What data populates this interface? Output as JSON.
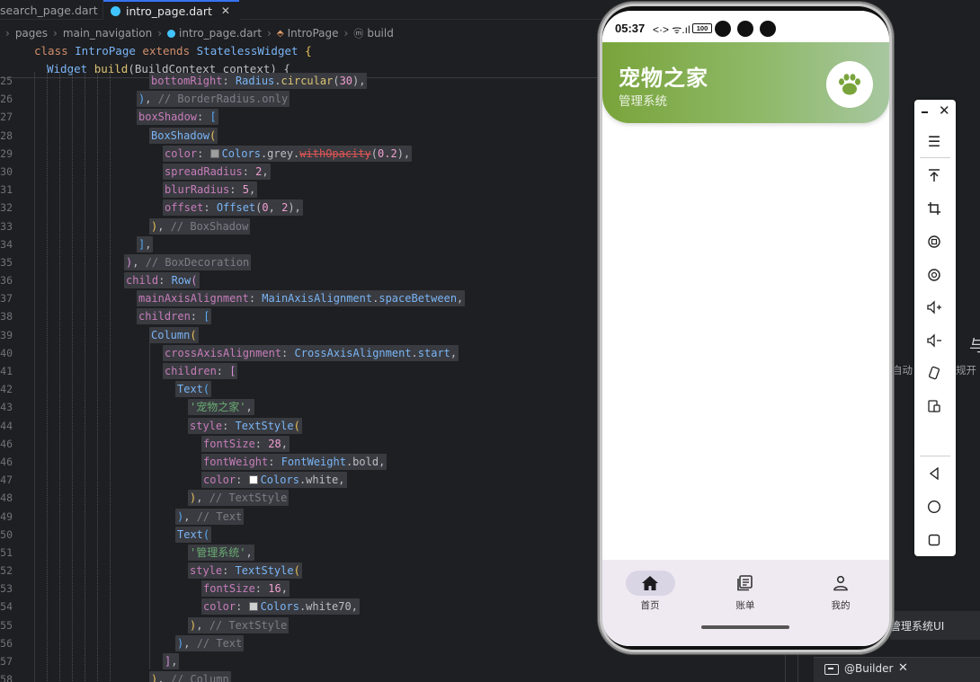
{
  "editor": {
    "tabs": [
      {
        "label": "search_page.dart",
        "active": false
      },
      {
        "label": "intro_page.dart",
        "active": true,
        "close": "✕"
      }
    ],
    "breadcrumb": [
      "pages",
      "main_navigation",
      "intro_page.dart",
      "IntroPage",
      "build"
    ],
    "sticky": [
      {
        "a": "class ",
        "b": "IntroPage ",
        "c": "extends ",
        "d": "StatelessWidget ",
        "e": "{"
      },
      {
        "a": "Widget ",
        "b": "build",
        "c": "(BuildContext context) {"
      }
    ],
    "line_numbers": [
      "25",
      "26",
      "27",
      "28",
      "29",
      "30",
      "31",
      "32",
      "33",
      "34",
      "35",
      "36",
      "37",
      "38",
      "39",
      "40",
      "41",
      "42",
      "43",
      "44",
      "46",
      "47",
      "48",
      "49",
      "50",
      "51",
      "52",
      "53",
      "54",
      "55",
      "56",
      "57",
      "58"
    ],
    "comments": {
      "border_radius_only": "// BorderRadius.only",
      "box_shadow": "// BoxShadow",
      "box_decoration": "// BoxDecoration",
      "text_style": "// TextStyle",
      "text": "// Text",
      "column": "// Column"
    },
    "strings": {
      "title": "'宠物之家'",
      "subtitle": "'管理系统'"
    },
    "numbers": {
      "opacity": "0.2",
      "spread": "2",
      "blur": "5",
      "offset_x": "0",
      "offset_y": "2",
      "title_size": "28",
      "sub_size": "16",
      "radius": "30"
    }
  },
  "phone": {
    "status": {
      "time": "05:37",
      "net": "<·> ᯤ.ıl",
      "battery": "100"
    },
    "appbar": {
      "title": "宠物之家",
      "subtitle": "管理系统"
    },
    "nav": [
      {
        "label": "首页",
        "icon": "home-icon",
        "active": true
      },
      {
        "label": "账单",
        "icon": "bill-icon",
        "active": false
      },
      {
        "label": "我的",
        "icon": "person-icon",
        "active": false
      }
    ],
    "colors": {
      "appbar_start": "#79a43b",
      "appbar_end": "#a7c7a0",
      "nav_bg": "#efeaf2"
    }
  },
  "right_panel": {
    "heading_fragment": "与",
    "text_left": "自动",
    "text_right": "规开",
    "card_text": "管理系统UI",
    "bottom_label": "@Builder"
  },
  "emulator_tools": {
    "minimize": "-",
    "close": "✕",
    "buttons": [
      "menu-icon",
      "pin-top-icon",
      "crop-icon",
      "rotate-left-icon",
      "rotate-right-icon",
      "volume-up-icon",
      "volume-down-icon",
      "shake-icon",
      "multi-device-icon",
      "back-icon",
      "home-circle-icon",
      "recent-apps-icon"
    ]
  }
}
